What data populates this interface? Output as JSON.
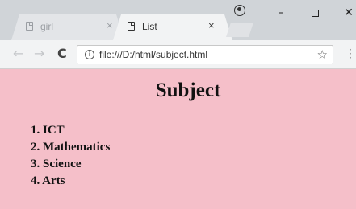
{
  "browser": {
    "tabs": [
      {
        "title": "girl",
        "active": false
      },
      {
        "title": "List",
        "active": true
      }
    ],
    "tab_close_glyph": "×",
    "window_controls": {
      "minimize": "–",
      "close": "✕"
    },
    "address_bar": {
      "url": "file:///D:/html/subject.html"
    },
    "icons": {
      "back": "back-arrow-icon",
      "forward": "forward-arrow-icon",
      "reload": "reload-icon",
      "info": "info-icon",
      "star": "bookmark-star-icon",
      "menu": "menu-dots-icon",
      "profile": "profile-icon"
    },
    "glyphs": {
      "back": "←",
      "forward": "→",
      "reload": "C",
      "info": "i",
      "star": "☆",
      "menu": "⋮"
    }
  },
  "page": {
    "background_color": "#f5bfc9",
    "heading": "Subject",
    "subjects": [
      "1. ICT",
      "2. Mathematics",
      "3. Science",
      "4. Arts"
    ]
  }
}
